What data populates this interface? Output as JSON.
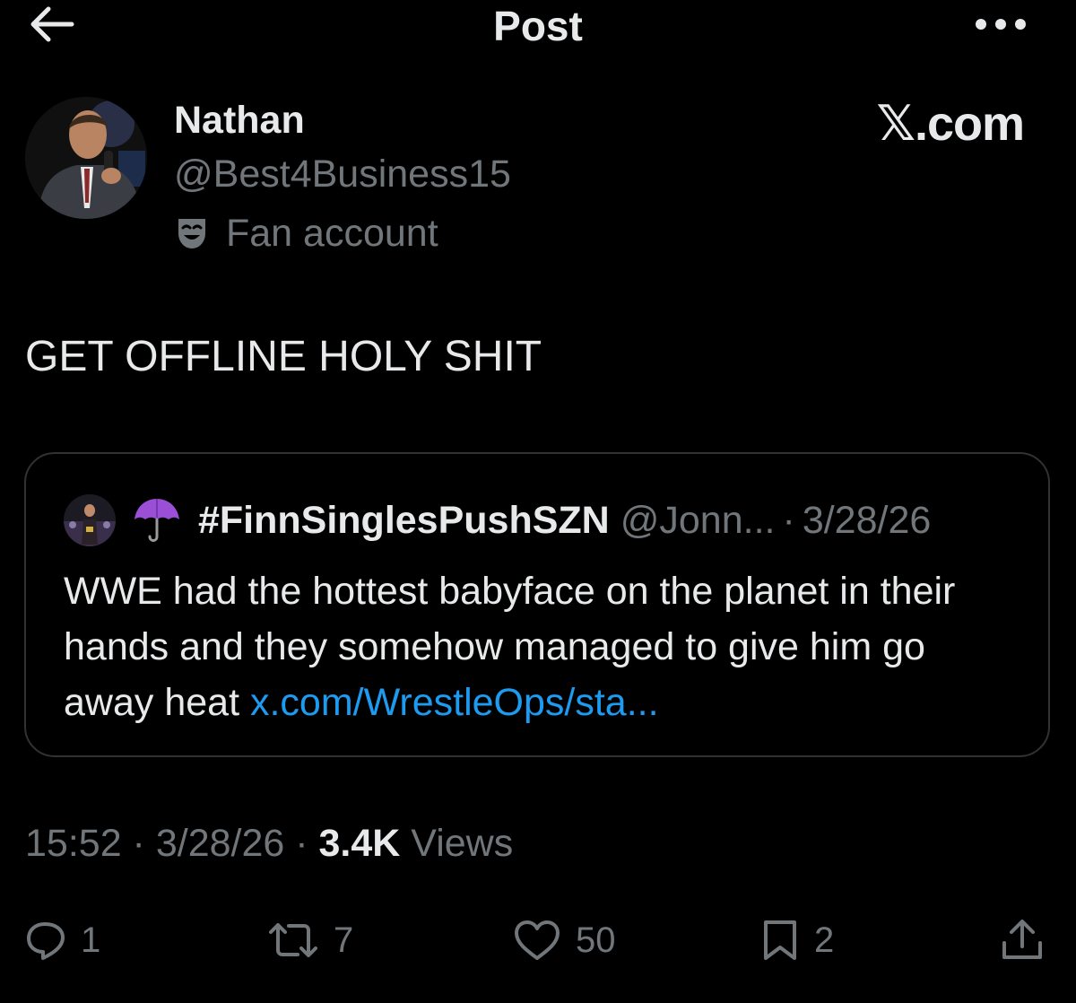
{
  "header": {
    "title": "Post",
    "back_icon": "arrow-left-icon",
    "more_icon": "more-horizontal-icon"
  },
  "author": {
    "name": "Nathan",
    "handle": "@Best4Business15",
    "label": "Fan account",
    "label_icon": "theater-mask-icon"
  },
  "source_label": "𝕏.com",
  "post": {
    "text": "GET OFFLINE HOLY SHIT"
  },
  "quote": {
    "emoji_icon": "umbrella-icon",
    "name": "#FinnSinglesPushSZN",
    "handle": "@Jonn...",
    "separator": "·",
    "date": "3/28/26",
    "text": "WWE had the hottest babyface on the planet in their hands and they somehow managed to give him go away heat ",
    "link": "x.com/WrestleOps/sta..."
  },
  "meta": {
    "time": "15:52",
    "sep1": " · ",
    "date": "3/28/26",
    "sep2": " · ",
    "views_count": "3.4K",
    "views_label": " Views"
  },
  "actions": {
    "reply_count": "1",
    "repost_count": "7",
    "like_count": "50",
    "bookmark_count": "2"
  },
  "colors": {
    "background": "#000000",
    "text": "#e7e9ea",
    "secondary": "#71767b",
    "link": "#1d9bf0",
    "border": "#2f3336",
    "umbrella": "#9b4fd6"
  }
}
